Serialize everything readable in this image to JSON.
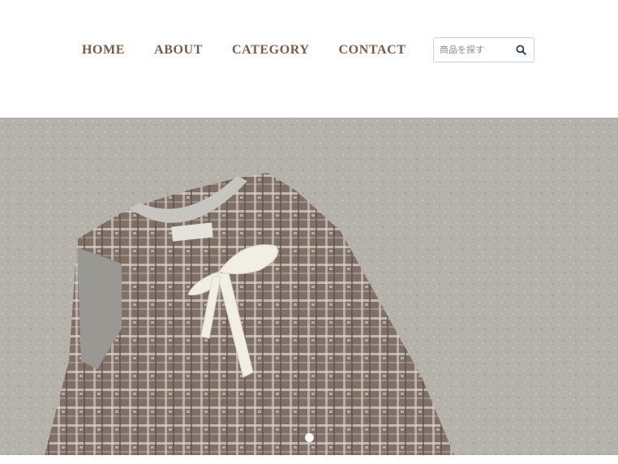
{
  "nav": {
    "items": [
      {
        "label": "HOME"
      },
      {
        "label": "ABOUT"
      },
      {
        "label": "CATEGORY"
      },
      {
        "label": "CONTACT"
      }
    ]
  },
  "search": {
    "placeholder": "商品を探す",
    "icon": "search-icon"
  },
  "hero": {
    "image": "tweed-sleeveless-dress-with-ribbon-photo",
    "slide_count": 1,
    "active_slide": 1
  },
  "colors": {
    "nav_text": "#7a5a49",
    "search_border": "#c9d3dc",
    "search_icon": "#2f3a57",
    "hero_bg": "#b5b1ab",
    "dress_base": "#7d6f66",
    "ribbon": "#f1eee4"
  }
}
